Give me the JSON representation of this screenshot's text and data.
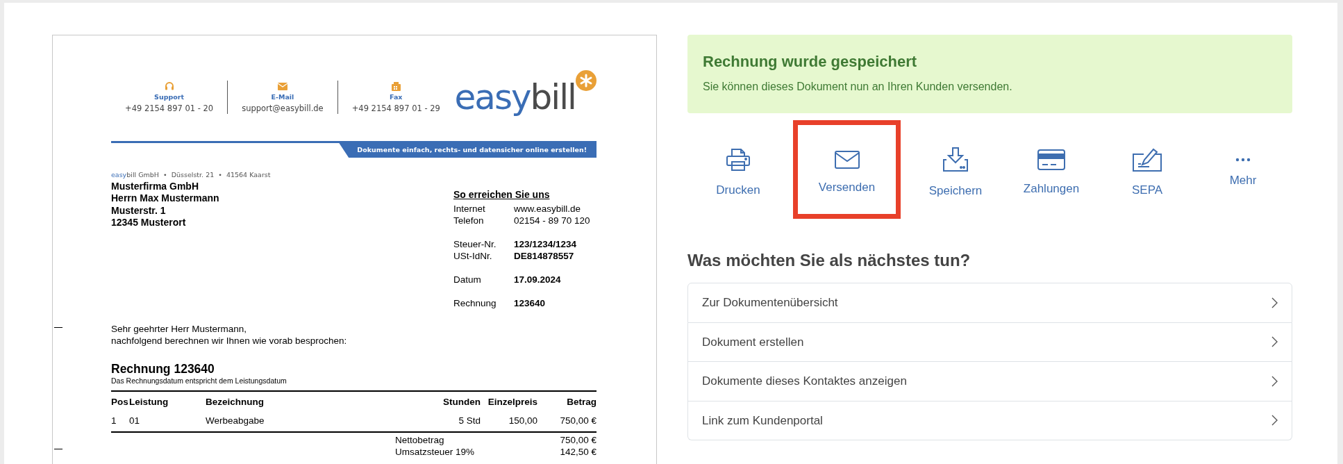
{
  "document": {
    "contacts": [
      {
        "label": "Support",
        "value": "+49 2154 897 01 - 20"
      },
      {
        "label": "E-Mail",
        "value": "support@easybill.de"
      },
      {
        "label": "Fax",
        "value": "+49 2154 897 01 - 29"
      }
    ],
    "logo": {
      "part_1": "easy",
      "part_2": "bill"
    },
    "banner": "Dokumente einfach, rechts- und datensicher online erstellen!",
    "sender_line": {
      "brand_1": "easy",
      "brand_2": "bill",
      "text": " GmbH  •  Düsselstr. 21  •  41564 Kaarst"
    },
    "recipient": [
      "Musterfirma GmbH",
      "Herrn Max Mustermann",
      "Musterstr. 1",
      "12345 Musterort"
    ],
    "contact_block": {
      "title": "So erreichen Sie uns",
      "groups": [
        [
          {
            "label": "Internet",
            "value": "www.easybill.de",
            "bold": false
          },
          {
            "label": "Telefon",
            "value": "02154 - 89 70 120",
            "bold": false
          }
        ],
        [
          {
            "label": "Steuer-Nr.",
            "value": "123/1234/1234",
            "bold": true
          },
          {
            "label": "USt-IdNr.",
            "value": "DE814878557",
            "bold": true
          }
        ],
        [
          {
            "label": "Datum",
            "value": "17.09.2024",
            "bold": true
          }
        ],
        [
          {
            "label": "Rechnung",
            "value": "123640",
            "bold": true
          }
        ]
      ]
    },
    "greeting": [
      "Sehr geehrter Herr Mustermann,",
      "nachfolgend berechnen wir Ihnen wie vorab besprochen:"
    ],
    "title": "Rechnung 123640",
    "subtitle": "Das Rechnungsdatum entspricht dem Leistungsdatum",
    "table": {
      "columns": [
        "Pos",
        "Leistung",
        "Bezeichnung",
        "Stunden",
        "Einzelpreis",
        "Betrag"
      ],
      "rows": [
        [
          "1",
          "01",
          "Werbeabgabe",
          "5 Std",
          "150,00",
          "750,00 €"
        ]
      ]
    },
    "totals": [
      {
        "label": "Nettobetrag",
        "value": "750,00 €"
      },
      {
        "label": "Umsatzsteuer 19%",
        "value": "142,50 €"
      }
    ]
  },
  "alert": {
    "title": "Rechnung wurde gespeichert",
    "text": "Sie können dieses Dokument nun an Ihren Kunden versenden."
  },
  "actions": [
    {
      "label": "Drucken",
      "highlighted": false
    },
    {
      "label": "Versenden",
      "highlighted": true
    },
    {
      "label": "Speichern",
      "highlighted": false
    },
    {
      "label": "Zahlungen",
      "highlighted": false
    },
    {
      "label": "SEPA",
      "highlighted": false
    },
    {
      "label": "Mehr",
      "highlighted": false
    }
  ],
  "next_steps": {
    "title": "Was möchten Sie als nächstes tun?",
    "items": [
      "Zur Dokumentenübersicht",
      "Dokument erstellen",
      "Dokumente dieses Kontaktes anzeigen",
      "Link zum Kundenportal"
    ]
  }
}
